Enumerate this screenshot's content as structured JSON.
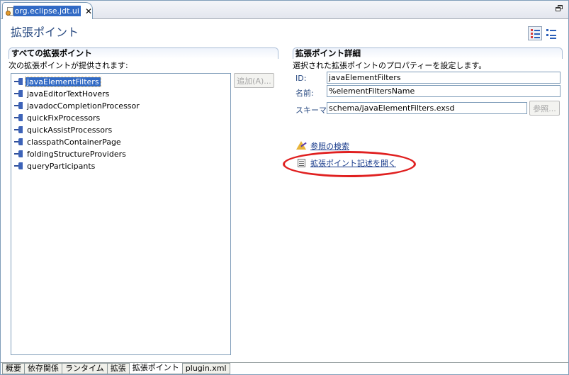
{
  "editor_tab": {
    "label": "org.eclipse.jdt.ui"
  },
  "form": {
    "title": "拡張ポイント"
  },
  "all_points": {
    "header": "すべての拡張ポイント",
    "description": "次の拡張ポイントが提供されます:",
    "items": [
      "javaElementFilters",
      "javaEditorTextHovers",
      "javadocCompletionProcessor",
      "quickFixProcessors",
      "quickAssistProcessors",
      "classpathContainerPage",
      "foldingStructureProviders",
      "queryParticipants"
    ],
    "selected_index": 0,
    "add_button": "追加(A)..."
  },
  "details": {
    "header": "拡張ポイント詳細",
    "description": "選択された拡張ポイントのプロパティーを設定します。",
    "id_label": "ID:",
    "id_value": "javaElementFilters",
    "name_label": "名前:",
    "name_value": "%elementFiltersName",
    "schema_label": "スキーマ:",
    "schema_value": "schema/javaElementFilters.exsd",
    "browse_button": "参照...",
    "find_refs_link": "参照の検索",
    "open_desc_link": "拡張ポイント記述を開く"
  },
  "annotation": {
    "color": "#e02020"
  },
  "bottom_tabs": [
    "概要",
    "依存関係",
    "ランタイム",
    "拡張",
    "拡張ポイント",
    "plugin.xml"
  ],
  "active_bottom_tab": 4
}
